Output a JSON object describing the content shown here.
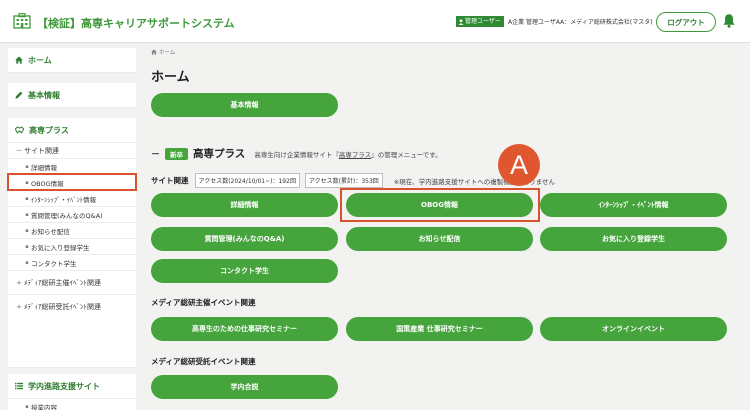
{
  "header": {
    "app_title": "【検証】高専キャリアサポートシステム",
    "role_badge": "管理ユーザー",
    "user_info": "A企業 管理ユーザAA：メディア総研株式会社(マスタ)",
    "logout_label": "ログアウト"
  },
  "sidebar": {
    "home": "ホーム",
    "basic_info": "基本情報",
    "kosen_plus": "高専プラス",
    "site_related": "サイト関連",
    "items": [
      "詳細情報",
      "OBOG情報",
      "ｲﾝﾀｰﾝｼｯﾌﾟ・ｲﾍﾞﾝﾄ情報",
      "質問管理(みんなのQ&A)",
      "お知らせ配信",
      "お気に入り登録学生",
      "コンタクト学生"
    ],
    "media_event": "ﾒﾃﾞｨｱ総研主催ｲﾍﾞﾝﾄ関連",
    "media_entrust": "ﾒﾃﾞｨｱ総研受託ｲﾍﾞﾝﾄ関連",
    "campus_support": "学内進路支援サイト",
    "cut_item": "授業内容"
  },
  "main": {
    "breadcrumb": "ホーム",
    "title": "ホーム",
    "basic_info_btn": "基本情報",
    "section": {
      "dash": "－",
      "new_tag": "新卒",
      "title": "高専プラス",
      "desc_pre": "高専生向け企業情報サイト『",
      "desc_link": "高専プラス",
      "desc_post": "』の管理メニューです。"
    },
    "site_label": "サイト関連",
    "access_day": "アクセス数(2024/10/01~)：192回",
    "access_total": "アクセス数(累計)：353回",
    "note": "※現在、学内進路支援サイトへの複製機能はありません",
    "site_buttons": [
      "詳細情報",
      "OBOG情報",
      "ｲﾝﾀｰﾝｼｯﾌﾟ・ｲﾍﾞﾝﾄ情報",
      "質問管理(みんなのQ&A)",
      "お知らせ配信",
      "お気に入り登録学生",
      "コンタクト学生"
    ],
    "media_heading": "メディア総研主催イベント関連",
    "media_buttons": [
      "高専生のための仕事研究セミナー",
      "国策産業 仕事研究セミナー",
      "オンラインイベント"
    ],
    "entrust_heading": "メディア総研受託イベント関連",
    "entrust_buttons": [
      "学内合説"
    ]
  },
  "annotation": {
    "marker": "A"
  },
  "colors": {
    "accent": "#45a43c",
    "brand_text": "#2f7d30",
    "highlight": "#d9532e",
    "background": "#f2f3f1"
  }
}
